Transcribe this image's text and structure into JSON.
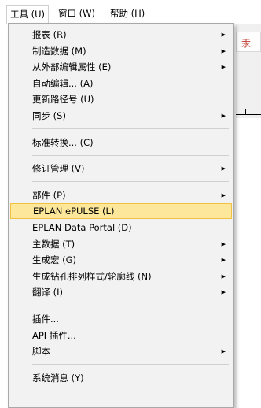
{
  "menubar": {
    "items": [
      {
        "label": "工具 (U)"
      },
      {
        "label": "窗口 (W)"
      },
      {
        "label": "帮助 (H)"
      }
    ]
  },
  "background": {
    "tab_glyph": "汞"
  },
  "menu": {
    "groups": [
      [
        {
          "label": "报表 (R)",
          "submenu": true
        },
        {
          "label": "制造数据 (M)",
          "submenu": true
        },
        {
          "label": "从外部编辑属性 (E)",
          "submenu": true
        },
        {
          "label": "自动编辑... (A)",
          "submenu": false
        },
        {
          "label": "更新路径号 (U)",
          "submenu": false
        },
        {
          "label": "同步 (S)",
          "submenu": true
        }
      ],
      [
        {
          "label": "标准转换... (C)",
          "submenu": false
        }
      ],
      [
        {
          "label": "修订管理 (V)",
          "submenu": true
        }
      ],
      [
        {
          "label": "部件 (P)",
          "submenu": true
        },
        {
          "label": "EPLAN ePULSE (L)",
          "submenu": false,
          "highlighted": true
        },
        {
          "label": "EPLAN Data Portal (D)",
          "submenu": false
        },
        {
          "label": "主数据 (T)",
          "submenu": true
        },
        {
          "label": "生成宏 (G)",
          "submenu": true
        },
        {
          "label": "生成钻孔排列样式/轮廓线 (N)",
          "submenu": true
        },
        {
          "label": "翻译 (I)",
          "submenu": true
        }
      ],
      [
        {
          "label": "插件...",
          "submenu": false
        },
        {
          "label": "API 插件...",
          "submenu": false
        },
        {
          "label": "脚本",
          "submenu": true
        }
      ],
      [
        {
          "label": "系统消息 (Y)",
          "submenu": false
        }
      ]
    ]
  }
}
